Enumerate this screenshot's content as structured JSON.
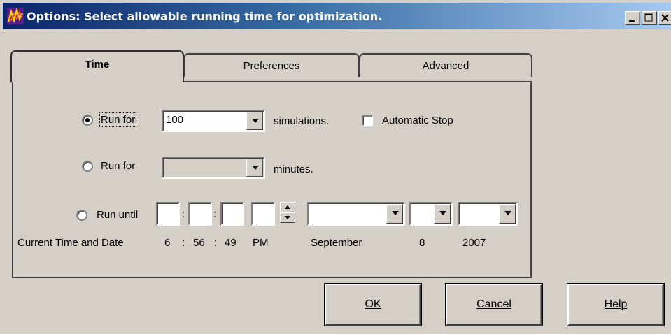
{
  "window": {
    "title": "Options: Select allowable running time for optimization."
  },
  "tabs": [
    {
      "label": "Time",
      "active": true
    },
    {
      "label": "Preferences",
      "active": false
    },
    {
      "label": "Advanced",
      "active": false
    }
  ],
  "time_tab": {
    "run_for_simulations": {
      "label": "Run for",
      "checked": true,
      "value": "100",
      "suffix": "simulations."
    },
    "automatic_stop": {
      "label": "Automatic Stop",
      "checked": false
    },
    "run_for_minutes": {
      "label": "Run for",
      "checked": false,
      "value": "",
      "suffix": "minutes."
    },
    "run_until": {
      "label": "Run until",
      "checked": false,
      "separator": ":"
    },
    "current": {
      "label": "Current Time and Date",
      "hour": "6",
      "sep1": ":",
      "minute": "56",
      "sep2": ":",
      "second": "49",
      "ampm": "PM",
      "month": "September",
      "day": "8",
      "year": "2007"
    }
  },
  "buttons": {
    "ok": "OK",
    "cancel": "Cancel",
    "help": "Help"
  }
}
